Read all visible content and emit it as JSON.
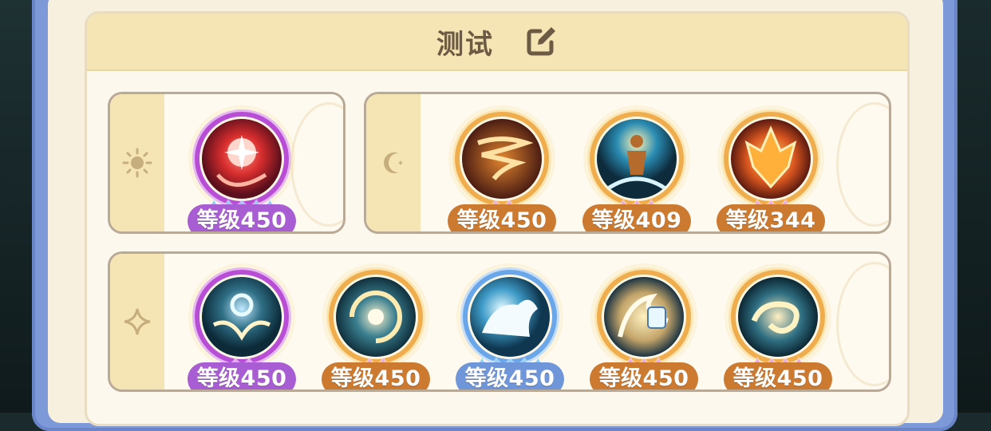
{
  "panel": {
    "title": "测试",
    "edit_icon": "edit-icon"
  },
  "groups": [
    {
      "icon": "sun-icon",
      "skills": [
        {
          "icon": "red-orb-skill-icon",
          "ring": "purple",
          "stars": 5,
          "star_color": "blue",
          "level": "等级450",
          "badge": "purple"
        }
      ]
    },
    {
      "icon": "moon-icon",
      "skills": [
        {
          "icon": "tornado-skill-icon",
          "ring": "orange",
          "stars": 2,
          "star_color": "pink",
          "level": "等级450",
          "badge": "orange"
        },
        {
          "icon": "rising-figure-skill-icon",
          "ring": "orange",
          "stars": 3,
          "star_color": "pink",
          "level": "等级409",
          "badge": "orange"
        },
        {
          "icon": "fire-crest-skill-icon",
          "ring": "orange",
          "stars": 3,
          "star_color": "pink",
          "level": "等级344",
          "badge": "orange"
        }
      ]
    },
    {
      "icon": "sparkle-icon",
      "skills": [
        {
          "icon": "winged-vortex-skill-icon",
          "ring": "purple",
          "stars": 2,
          "star_color": "pink",
          "level": "等级450",
          "badge": "purple"
        },
        {
          "icon": "swirl-vortex-skill-icon",
          "ring": "orange",
          "stars": 2,
          "star_color": "pink",
          "level": "等级450",
          "badge": "orange"
        },
        {
          "icon": "wave-beast-skill-icon",
          "ring": "blue",
          "stars": 5,
          "star_color": "blue",
          "level": "等级450",
          "badge": "blue"
        },
        {
          "icon": "cyclone-shield-skill-icon",
          "ring": "orange",
          "stars": 3,
          "star_color": "pink",
          "level": "等级450",
          "badge": "orange"
        },
        {
          "icon": "spiral-wind-skill-icon",
          "ring": "orange",
          "stars": 4,
          "star_color": "pink",
          "level": "等级450",
          "badge": "orange"
        }
      ]
    }
  ]
}
